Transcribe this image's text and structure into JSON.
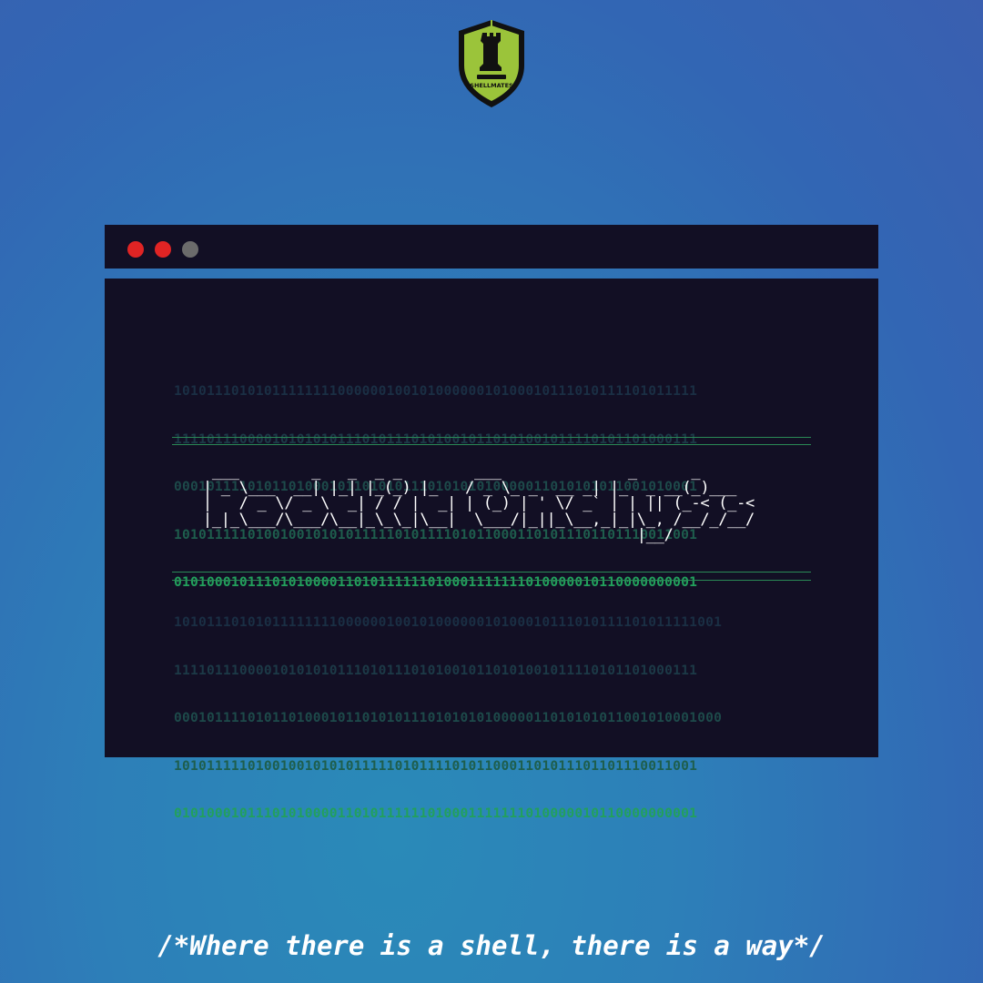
{
  "logo": {
    "text": "SHELLMATES",
    "colors": {
      "shield": "#9bc43a",
      "outline": "#111111"
    }
  },
  "window": {
    "controls": [
      {
        "name": "close",
        "color": "#e02424"
      },
      {
        "name": "minimize",
        "color": "#e02424"
      },
      {
        "name": "maximize",
        "color": "#6b6b6b"
      }
    ],
    "binary_top": [
      "1010111010101111111100000010010100000010100010111010111101011111",
      "1111011100001010101011101011101010010110101001011110101101000111",
      "0001011110101101000101101010111010101010000011010101011001010001",
      "1010111110100100101010111110101111010110001101011101101110011001",
      "0101000101110101000011010111111010001111111010000010110000000001"
    ],
    "ascii_art": [
      "  ___        _   _  _ _        ___              _      _          ",
      " | _ \\___  __| |_| |_(_) |_   / _ \\_ _  __ _| |_  _ __(_)___",
      " |   / _ \\/ _ \\  _| / / |  _| | (_) | ' \\/ _` | | || (_-< (_-<",
      " |_|_\\___/\\___/\\__|_\\_\\_|\\__|  \\___/|_||_\\__,_|_|\\_, /__/_/__/",
      "                                                 |__/         "
    ],
    "binary_bottom": [
      "1010111010101111111100000010010100000010100010111010111101011111001",
      "1111011100001010101011101011101010010110101001011110101101000111",
      "0001011110101101000101101010111010101010000011010101011001010001000",
      "1010111110100100101010111110101111010110001101011101101110011001",
      "0101000101110101000011010111111010001111111010000010110000000001"
    ]
  },
  "tagline": "/*Where there is a shell, there is a way*/"
}
